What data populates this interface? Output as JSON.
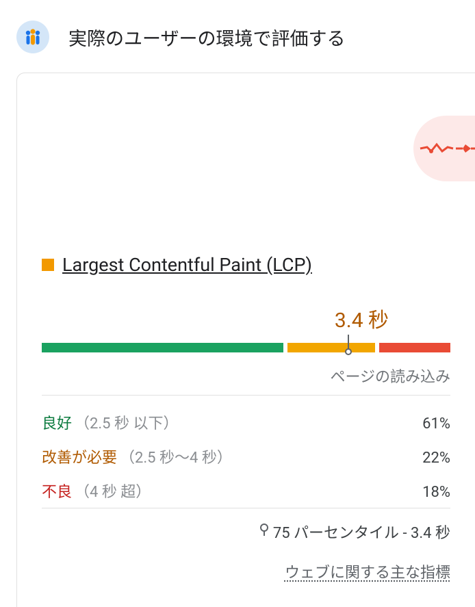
{
  "header": {
    "title": "実際のユーザーの環境で評価する"
  },
  "metric": {
    "name": "Largest Contentful Paint (LCP)",
    "value": "3.4 秒",
    "subtitle": "ページの読み込み",
    "distribution": {
      "good_pct": 61,
      "ni_pct": 22,
      "poor_pct": 18,
      "percentile_pos": 75
    },
    "breakdown": {
      "good": {
        "label": "良好",
        "range": "（2.5 秒 以下）",
        "pct": "61%"
      },
      "ni": {
        "label": "改善が必要",
        "range": "（2.5 秒～4 秒）",
        "pct": "22%"
      },
      "poor": {
        "label": "不良",
        "range": "（4 秒 超）",
        "pct": "18%"
      }
    },
    "footnote": "75 パーセンタイル - 3.4 秒",
    "link": "ウェブに関する主な指標"
  }
}
